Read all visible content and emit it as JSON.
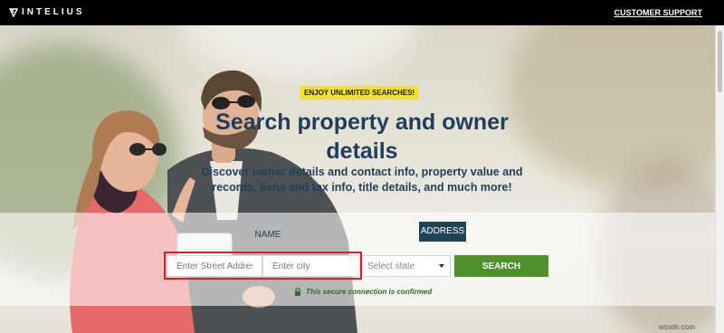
{
  "brand": {
    "name": "INTELIUS"
  },
  "header": {
    "support_link": "CUSTOMER SUPPORT"
  },
  "hero": {
    "badge": "ENJOY UNLIMITED SEARCHES!",
    "headline": "Search property and owner details",
    "subtext": "Discover owner details and contact info, property value and records, liens and tax info, title details, and much more!"
  },
  "search": {
    "tabs": [
      {
        "label": "NAME",
        "active": false
      },
      {
        "label": "ADDRESS",
        "active": true
      }
    ],
    "street_placeholder": "Enter Street Address",
    "city_placeholder": "Enter city",
    "state_selected": "Select state",
    "button_label": "SEARCH",
    "secure_note": "This secure connection is confirmed"
  },
  "watermark": "wsxdn.com",
  "colors": {
    "topbar": "#000000",
    "badge": "#f5e318",
    "headline": "#1e3e5c",
    "active_tab": "#1f4256",
    "search_button": "#4f9129",
    "highlight": "#d8212a"
  }
}
